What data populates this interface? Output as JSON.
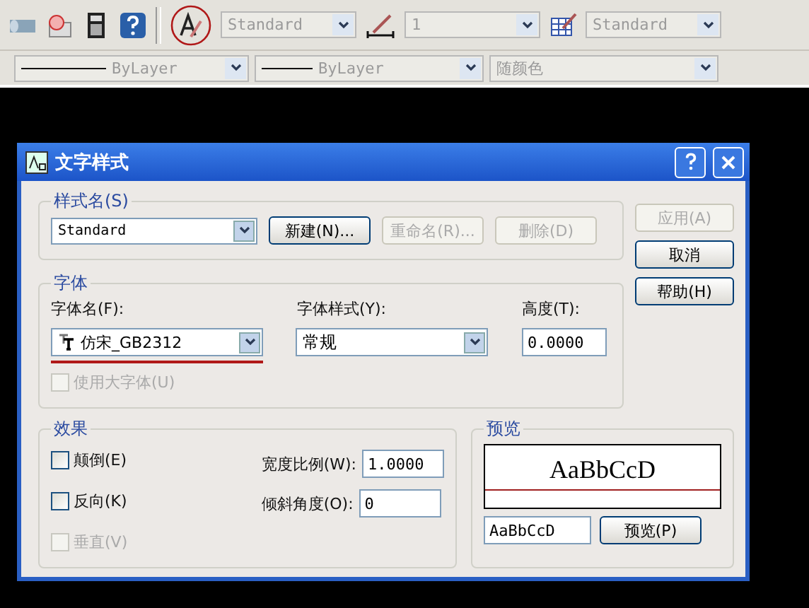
{
  "toolbar": {
    "combos": [
      {
        "kind": "text",
        "value": "Standard"
      },
      {
        "kind": "dim",
        "value": "1"
      },
      {
        "kind": "table",
        "value": "Standard"
      }
    ]
  },
  "properties_bar": {
    "combos": [
      {
        "kind": "line",
        "value": "ByLayer"
      },
      {
        "kind": "line",
        "value": "ByLayer"
      },
      {
        "kind": "plain",
        "value": "随颜色"
      }
    ]
  },
  "dialog": {
    "title": "文字样式",
    "style_name": {
      "label": "样式名(S)",
      "value": "Standard",
      "buttons": [
        {
          "label": "新建(N)...",
          "disabled": false
        },
        {
          "label": "重命名(R)...",
          "disabled": true
        },
        {
          "label": "删除(D)",
          "disabled": true
        }
      ]
    },
    "side_buttons": [
      {
        "label": "应用(A)",
        "disabled": true
      },
      {
        "label": "取消",
        "disabled": false
      },
      {
        "label": "帮助(H)",
        "disabled": false
      }
    ],
    "font": {
      "label": "字体",
      "name_label": "字体名(F):",
      "name_value": "仿宋_GB2312",
      "style_label": "字体样式(Y):",
      "style_value": "常规",
      "height_label": "高度(T):",
      "height_value": "0.0000",
      "bigfont": {
        "label": "使用大字体(U)",
        "checked": false,
        "disabled": true
      }
    },
    "effects": {
      "label": "效果",
      "checks": [
        {
          "label": "颠倒(E)",
          "checked": false,
          "disabled": false
        },
        {
          "label": "反向(K)",
          "checked": false,
          "disabled": false
        },
        {
          "label": "垂直(V)",
          "checked": false,
          "disabled": true
        }
      ],
      "width_label": "宽度比例(W):",
      "width_value": "1.0000",
      "oblique_label": "倾斜角度(O):",
      "oblique_value": "0"
    },
    "preview": {
      "label": "预览",
      "sample": "AaBbCcD",
      "input": "AaBbCcD",
      "button": "预览(P)"
    }
  }
}
